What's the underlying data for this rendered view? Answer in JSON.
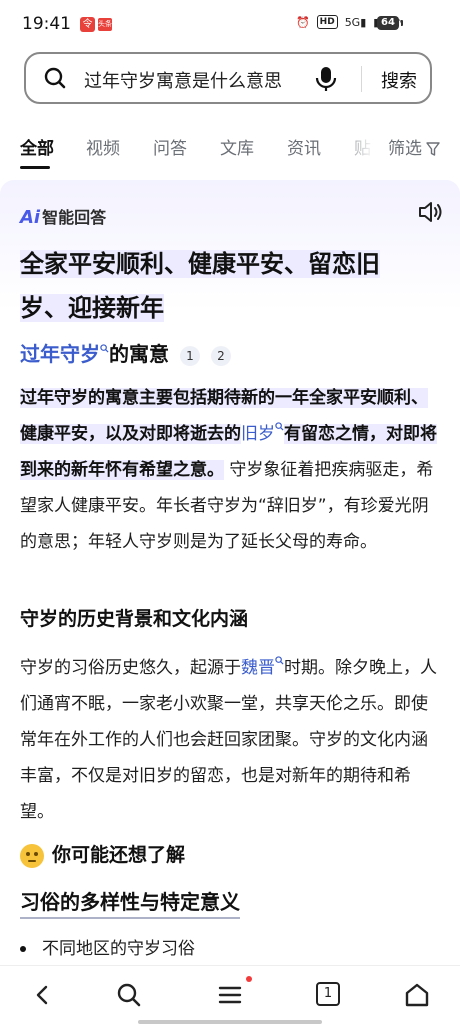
{
  "status": {
    "time": "19:41",
    "notif1": "令",
    "notif2": "头条",
    "hd": "HD",
    "signal": "5G",
    "battery": "64"
  },
  "search": {
    "query": "过年守岁寓意是什么意思",
    "button_label": "搜索"
  },
  "tabs": [
    {
      "label": "全部"
    },
    {
      "label": "视频"
    },
    {
      "label": "问答"
    },
    {
      "label": "文库"
    },
    {
      "label": "资讯"
    },
    {
      "label": "贴"
    }
  ],
  "filter_label": "筛选",
  "ai_card": {
    "badge": "智能回答",
    "badge_ai": "Ai",
    "title_line1": "全家平安顺利、健康平安、留恋旧",
    "title_line2": "岁、迎接新年",
    "subhead_link": "过年守岁",
    "subhead_rest": "的寓意",
    "refs": [
      "1",
      "2"
    ],
    "p1_bold_a": "过年守岁的寓意主要包括期待新的一年全家平安顺利、健康平安，以及对即将逝去的",
    "p1_link": "旧岁",
    "p1_bold_b": "有留恋之情，对即将到来的新年怀有希望之意。",
    "p1_rest": "守岁象征着把疾病驱走，希望家人健康平安。年长者守岁为“辞旧岁”，有珍爱光阴的意思；年轻人守岁则是为了延长父母的寿命。",
    "section_title": "守岁的历史背景和文化内涵",
    "p2_a": "守岁的习俗历史悠久，起源于",
    "p2_link": "魏晋",
    "p2_b": "时期。除夕晚上，人们通宵不眠，一家老小欢聚一堂，共享天伦之乐。即使常年在外工作的人们也会赶回家团聚。守岁的文化内涵丰富，不仅是对旧岁的留恋，也是对新年的期待和希望。",
    "maybe_title": "你可能还想了解",
    "topic_title": "习俗的多样性与特定意义",
    "bullet": "不同地区的守岁习俗"
  },
  "bottom_nav": {
    "tabs_count": "1"
  },
  "colors": {
    "link": "#3a5ccc",
    "highlight": "#ecebff",
    "accent": "#4a5ae8"
  }
}
